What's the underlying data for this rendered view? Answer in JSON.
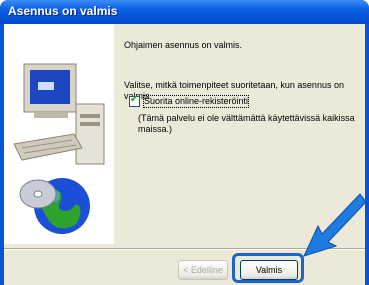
{
  "window": {
    "title": "Asennus on valmis"
  },
  "content": {
    "line1": "Ohjaimen asennus on valmis.",
    "line2": "Valitse, mitkä toimenpiteet suoritetaan, kun asennus on valmis.",
    "checkbox_label": "Suorita online-rekisteröinti",
    "checkbox_checked": true,
    "note_line1": "(Tämä palvelu ei ole välttämättä käytettävissä kaikissa",
    "note_line2": "maissa.)"
  },
  "buttons": {
    "back": "< Edelline",
    "finish": "Valmis"
  },
  "colors": {
    "title_bar": "#0a5fe3",
    "highlight": "#1e64c8",
    "arrow": "#1e7be0"
  },
  "icons": [
    "computer-icon",
    "globe-icon",
    "cd-icon",
    "arrow-icon"
  ]
}
